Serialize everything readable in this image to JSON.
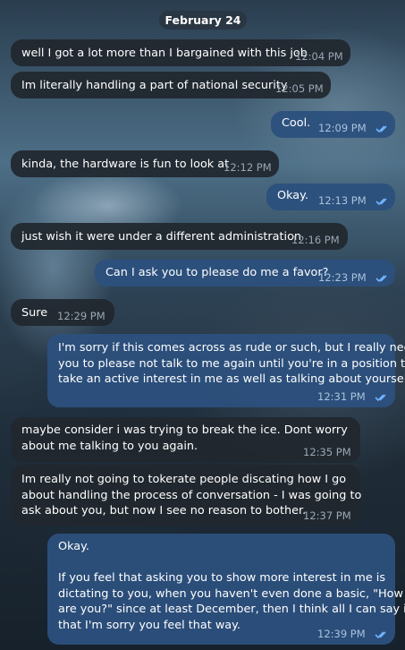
{
  "date_divider": "February 24",
  "messages": [
    {
      "dir": "in",
      "text": "well I got a lot more than I bargained with this job",
      "time": "12:04 PM"
    },
    {
      "dir": "in",
      "text": "Im literally handling a part of national security",
      "time": "12:05 PM"
    },
    {
      "dir": "out",
      "text": "Cool.",
      "time": "12:09 PM"
    },
    {
      "dir": "in",
      "text": "kinda, the hardware is fun to look at",
      "time": "12:12 PM"
    },
    {
      "dir": "out",
      "text": "Okay.",
      "time": "12:13 PM"
    },
    {
      "dir": "in",
      "text": "just wish it were under a different administration",
      "time": "12:16 PM"
    },
    {
      "dir": "out",
      "text": "Can I ask you to please do me a favor?",
      "time": "12:23 PM"
    },
    {
      "dir": "in",
      "text": "Sure",
      "time": "12:29 PM"
    },
    {
      "dir": "out",
      "text": "I'm sorry if this comes across as rude or such, but I really need\nyou to please not talk to me again until you're in a position to\ntake an active interest in me as well as talking about yourself.",
      "time": "12:31 PM"
    },
    {
      "dir": "in",
      "text": "maybe consider i was trying to break the ice. Dont worry\nabout me talking to you again.",
      "time": "12:35 PM"
    },
    {
      "dir": "in",
      "text": "Im really not going to tokerate people discating how I go\nabout handling the process of conversation - I was going to\nask about you, but now I see no reason to bother.",
      "time": "12:37 PM"
    },
    {
      "dir": "out",
      "text": "Okay.\n\nIf you feel that asking you to show more interest in me is\ndictating to you, when you haven't even done a basic, \"How\nare you?\" since at least December, then I think all I can say is\nthat I'm sorry you feel that way.",
      "time": "12:39 PM"
    }
  ]
}
